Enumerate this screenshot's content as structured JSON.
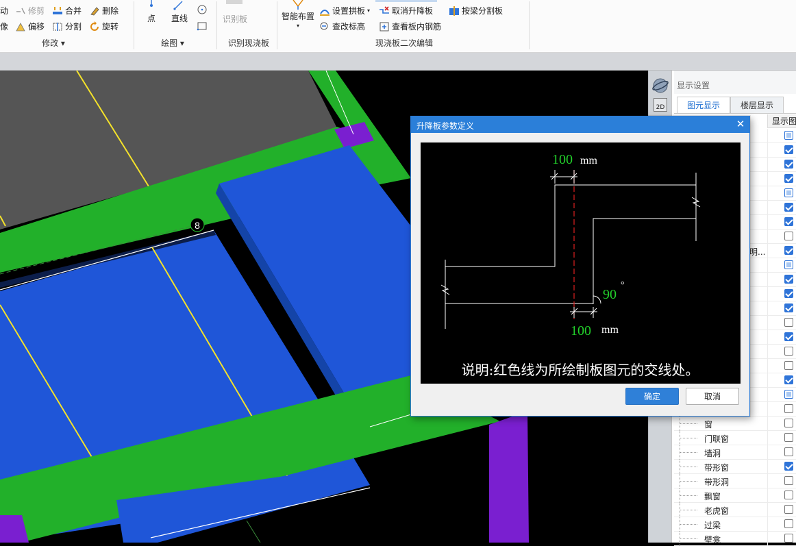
{
  "ribbon": {
    "modify": {
      "move": "动",
      "trim": "修剪",
      "merge": "合并",
      "delete": "删除",
      "mirror": "像",
      "offset": "偏移",
      "split": "分割",
      "rotate": "旋转",
      "label": "修改"
    },
    "draw": {
      "point": "点",
      "line": "直线",
      "label": "绘图"
    },
    "identify": {
      "button": "识别板",
      "label": "识别现浇板"
    },
    "edit2": {
      "smart_layout": "智能布置",
      "set_arch": "设置拱板",
      "cancel_drop": "取消升降板",
      "split_by_beam": "按梁分割板",
      "check_elev": "查改标高",
      "view_rebar": "查看板内钢筋",
      "label": "现浇板二次编辑"
    }
  },
  "scene": {
    "axis_marker": "8"
  },
  "view_strip": {
    "btn_2d": "2D"
  },
  "panel": {
    "title": "显示设置",
    "tabs": [
      "图元显示",
      "楼层显示"
    ],
    "column_header": "显示图",
    "partial_label": "明...",
    "rows": [
      {
        "label": "",
        "state": "part"
      },
      {
        "label": "",
        "state": "on"
      },
      {
        "label": "",
        "state": "on"
      },
      {
        "label": "",
        "state": "on"
      },
      {
        "label": "",
        "state": "part"
      },
      {
        "label": "",
        "state": "on"
      },
      {
        "label": "",
        "state": "on"
      },
      {
        "label": "",
        "state": "off"
      },
      {
        "label": "",
        "state": "on"
      },
      {
        "label": "",
        "state": "part"
      },
      {
        "label": "",
        "state": "on"
      },
      {
        "label": "",
        "state": "on"
      },
      {
        "label": "",
        "state": "on"
      },
      {
        "label": "",
        "state": "off"
      },
      {
        "label": "",
        "state": "on"
      },
      {
        "label": "",
        "state": "off"
      },
      {
        "label": "",
        "state": "off"
      },
      {
        "label": "",
        "state": "on"
      },
      {
        "label": "",
        "state": "part"
      },
      {
        "label": "",
        "state": "off"
      },
      {
        "label": "窗",
        "state": "off"
      },
      {
        "label": "门联窗",
        "state": "off"
      },
      {
        "label": "墙洞",
        "state": "off"
      },
      {
        "label": "带形窗",
        "state": "on"
      },
      {
        "label": "带形洞",
        "state": "off"
      },
      {
        "label": "飘窗",
        "state": "off"
      },
      {
        "label": "老虎窗",
        "state": "off"
      },
      {
        "label": "过梁",
        "state": "off"
      },
      {
        "label": "壁龛",
        "state": "off"
      }
    ]
  },
  "dialog": {
    "title": "升降板参数定义",
    "top_value": "100",
    "top_unit": "mm",
    "angle_value": "90",
    "angle_unit": "°",
    "bottom_value": "100",
    "bottom_unit": "mm",
    "note": "说明:红色线为所绘制板图元的交线处。",
    "ok": "确定",
    "cancel": "取消"
  },
  "colors": {
    "slab_blue": "#1f56d8",
    "beam_green": "#22b02a",
    "column_purple": "#7a1fd0",
    "slab_grey": "#555555",
    "dialog_blue": "#2b7fd9",
    "value_green": "#22d02a"
  }
}
